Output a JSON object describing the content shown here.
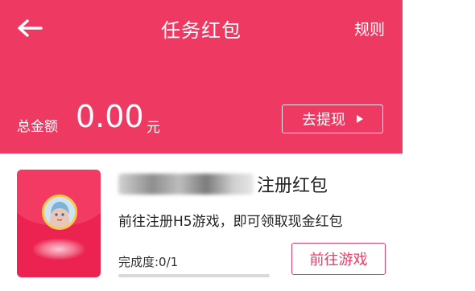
{
  "header": {
    "title": "任务红包",
    "rules_label": "规则",
    "back_icon": "arrow-left-icon",
    "total_label": "总金额",
    "total_amount": "0.00",
    "total_unit": "元",
    "withdraw_label": "去提现",
    "withdraw_icon": "play-triangle-icon",
    "accent_color": "#ee3a62"
  },
  "task": {
    "title_suffix": "注册红包",
    "description": "前往注册H5游戏，即可领取现金红包",
    "progress_text": "完成度:0/1",
    "progress_fraction": 0,
    "go_button_label": "前往游戏",
    "envelope_color": "#ec2350"
  }
}
